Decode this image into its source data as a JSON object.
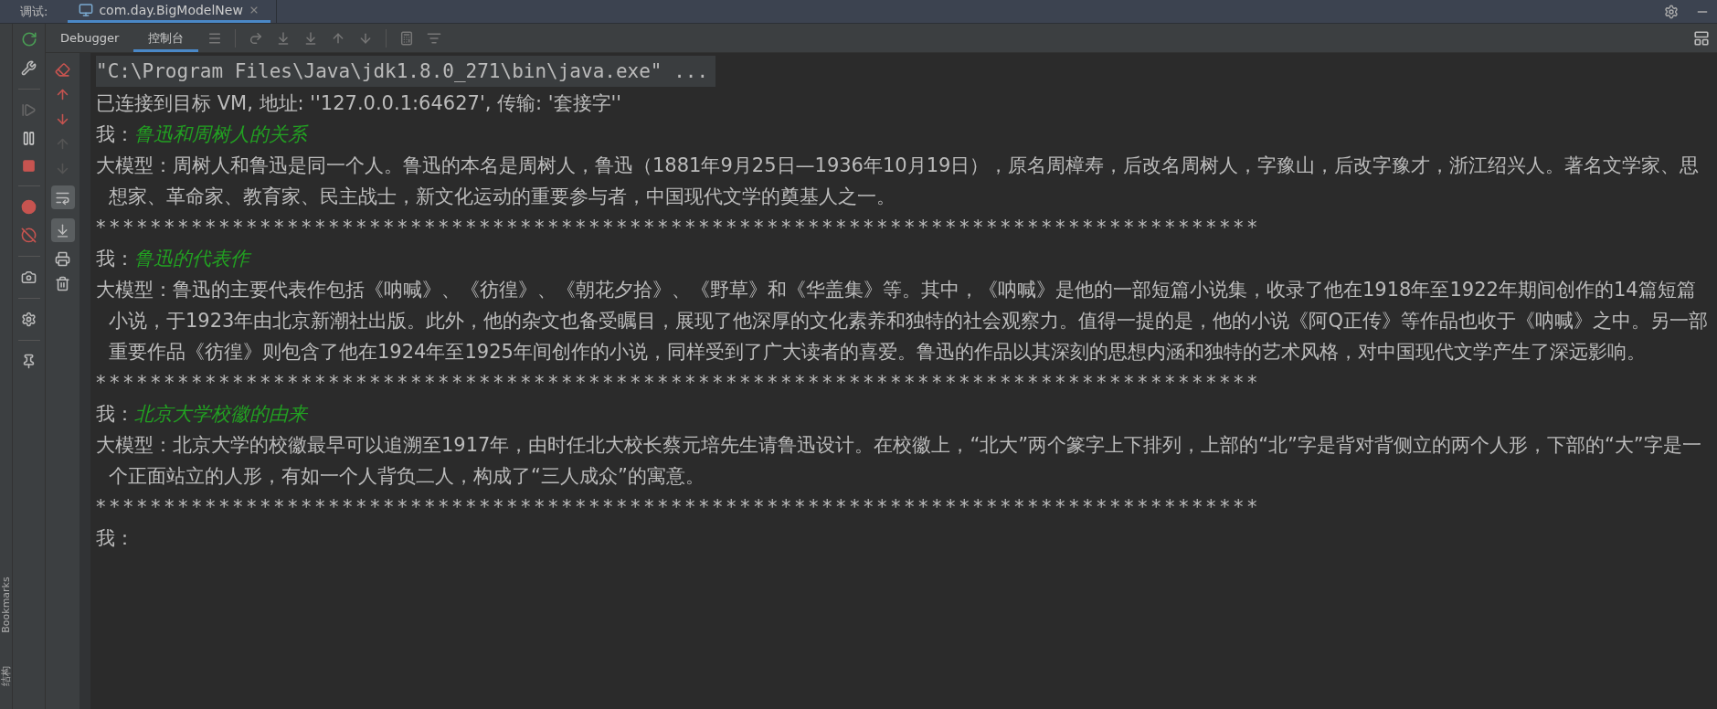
{
  "top_bar": {
    "label": "调试:",
    "tab": {
      "title": "com.day.BigModelNew",
      "selected": true
    }
  },
  "toolbar": {
    "tabs": [
      {
        "label": "Debugger",
        "selected": false
      },
      {
        "label": "控制台",
        "selected": true
      }
    ]
  },
  "console_toggles": {
    "soft_wrap": {
      "on": true
    },
    "scroll_to_end": {
      "on": true
    }
  },
  "side_strip": {
    "labels": [
      "Bookmarks",
      "结构"
    ]
  },
  "console": {
    "lines": [
      {
        "kind": "command",
        "text": "\"C:\\Program Files\\Java\\jdk1.8.0_271\\bin\\java.exe\" ..."
      },
      {
        "kind": "plain",
        "text": "已连接到目标 VM, 地址: ''127.0.0.1:64627', 传输: '套接字''"
      },
      {
        "kind": "prompt",
        "label": "我：",
        "text": "鲁迅和周树人的关系"
      },
      {
        "kind": "plain",
        "text": "大模型：周树人和鲁迅是同一个人。鲁迅的本名是周树人，鲁迅（1881年9月25日—1936年10月19日），原名周樟寿，后改名周树人，字豫山，后改字豫才，浙江绍兴人。著名文学家、思想家、革命家、教育家、民主战士，新文化运动的重要参与者，中国现代文学的奠基人之一。"
      },
      {
        "kind": "separator",
        "text": "*************************************************************************************"
      },
      {
        "kind": "prompt",
        "label": "我：",
        "text": "鲁迅的代表作"
      },
      {
        "kind": "plain",
        "text": "大模型：鲁迅的主要代表作包括《呐喊》、《彷徨》、《朝花夕拾》、《野草》和《华盖集》等。其中，《呐喊》是他的一部短篇小说集，收录了他在1918年至1922年期间创作的14篇短篇小说，于1923年由北京新潮社出版。此外，他的杂文也备受瞩目，展现了他深厚的文化素养和独特的社会观察力。值得一提的是，他的小说《阿Q正传》等作品也收于《呐喊》之中。另一部重要作品《彷徨》则包含了他在1924年至1925年间创作的小说，同样受到了广大读者的喜爱。鲁迅的作品以其深刻的思想内涵和独特的艺术风格，对中国现代文学产生了深远影响。"
      },
      {
        "kind": "separator",
        "text": "*************************************************************************************"
      },
      {
        "kind": "prompt",
        "label": "我：",
        "text": "北京大学校徽的由来"
      },
      {
        "kind": "plain",
        "text": "大模型：北京大学的校徽最早可以追溯至1917年，由时任北大校长蔡元培先生请鲁迅设计。在校徽上，“北大”两个篆字上下排列，上部的“北”字是背对背侧立的两个人形，下部的“大”字是一个正面站立的人形，有如一个人背负二人，构成了“三人成众”的寓意。"
      },
      {
        "kind": "separator",
        "text": "*************************************************************************************"
      },
      {
        "kind": "prompt",
        "label": "我："
      }
    ]
  }
}
